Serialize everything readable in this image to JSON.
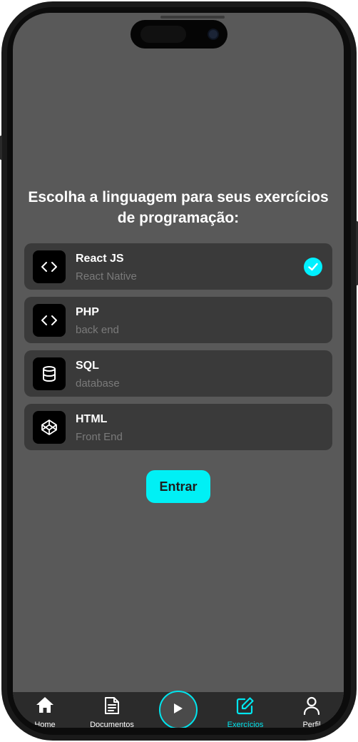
{
  "title": "Escolha a linguagem para seus exercícios de programação:",
  "languages": [
    {
      "name": "React JS",
      "subtitle": "React Native",
      "icon": "code-icon",
      "selected": true
    },
    {
      "name": "PHP",
      "subtitle": "back end",
      "icon": "code-icon",
      "selected": false
    },
    {
      "name": "SQL",
      "subtitle": "database",
      "icon": "database-icon",
      "selected": false
    },
    {
      "name": "HTML",
      "subtitle": "Front End",
      "icon": "codepen-icon",
      "selected": false
    }
  ],
  "enter_label": "Entrar",
  "tabs": [
    {
      "label": "Home",
      "icon": "home-icon",
      "active": false
    },
    {
      "label": "Documentos",
      "icon": "document-icon",
      "active": false
    },
    {
      "label": "Exercícios",
      "icon": "edit-icon",
      "active": true
    },
    {
      "label": "Perfil",
      "icon": "user-icon",
      "active": false
    }
  ],
  "center_button_icon": "play-icon",
  "colors": {
    "accent": "#00f0f5",
    "background": "#595959",
    "card": "#3a3a3a",
    "tabbar": "#2b2b2b"
  }
}
